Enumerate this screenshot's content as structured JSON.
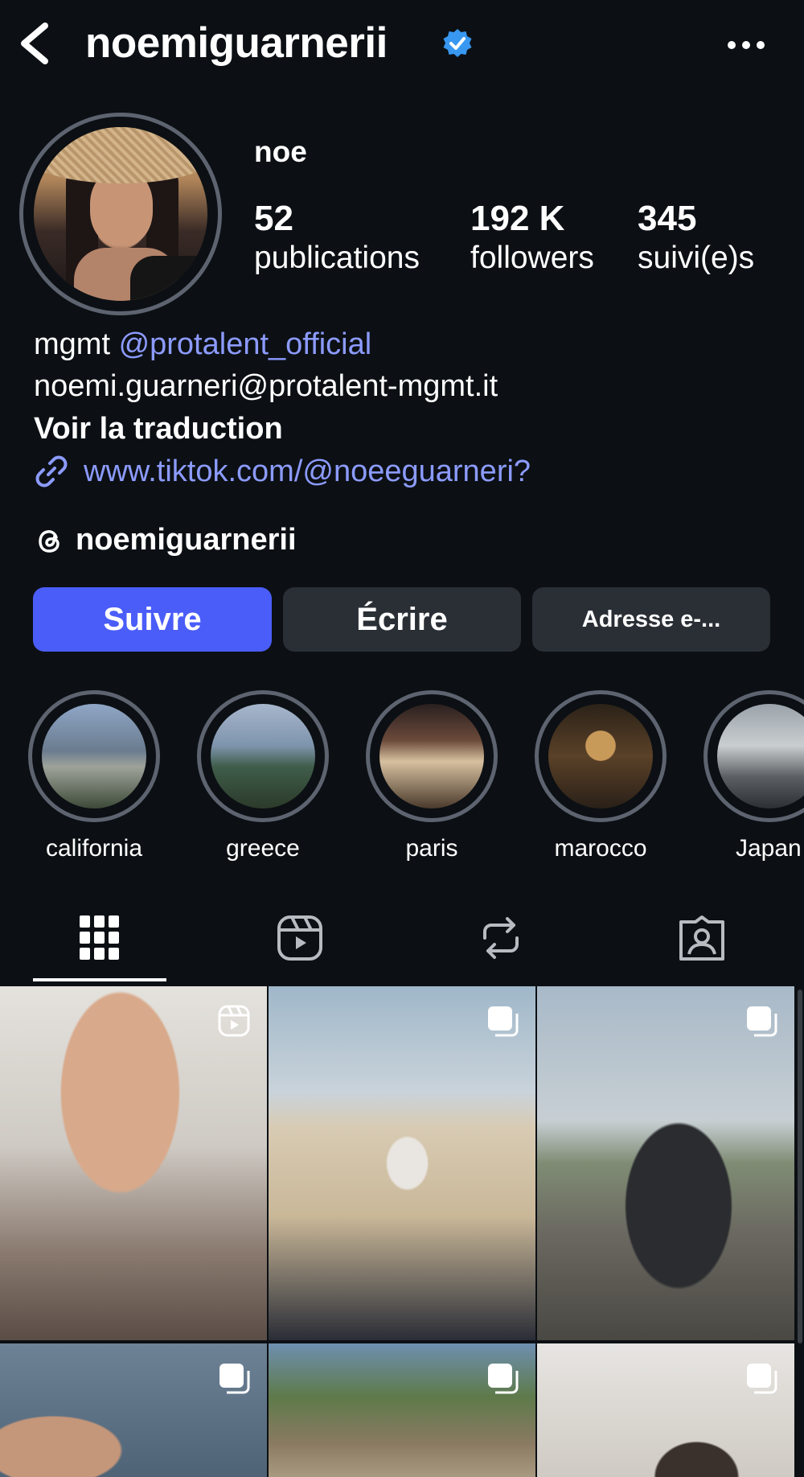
{
  "header": {
    "username": "noemiguarnerii"
  },
  "profile": {
    "display_name": "noe",
    "stats": [
      {
        "value": "52",
        "label": "publications"
      },
      {
        "value": "192 K",
        "label": "followers"
      },
      {
        "value": "345",
        "label": "suivi(e)s"
      }
    ]
  },
  "bio": {
    "line1_prefix": "mgmt ",
    "line1_mention": "@protalent_official",
    "line2": "noemi.guarneri@protalent-mgmt.it",
    "translate": "Voir la traduction",
    "link": "www.tiktok.com/@noeeguarneri?",
    "threads_handle": "noemiguarnerii"
  },
  "actions": {
    "follow": "Suivre",
    "message": "Écrire",
    "email": "Adresse e-..."
  },
  "highlights": [
    {
      "label": "california"
    },
    {
      "label": "greece"
    },
    {
      "label": "paris"
    },
    {
      "label": "marocco"
    },
    {
      "label": "Japan"
    }
  ],
  "tabs": [
    {
      "icon": "grid-icon",
      "active": true
    },
    {
      "icon": "reels-icon",
      "active": false
    },
    {
      "icon": "reposts-icon",
      "active": false
    },
    {
      "icon": "tagged-icon",
      "active": false
    }
  ],
  "colors": {
    "background": "#0c1014",
    "accent": "#4a5df9",
    "link": "#8c9bff",
    "verified": "#3897f0",
    "secondary_button": "#2a2f36"
  }
}
